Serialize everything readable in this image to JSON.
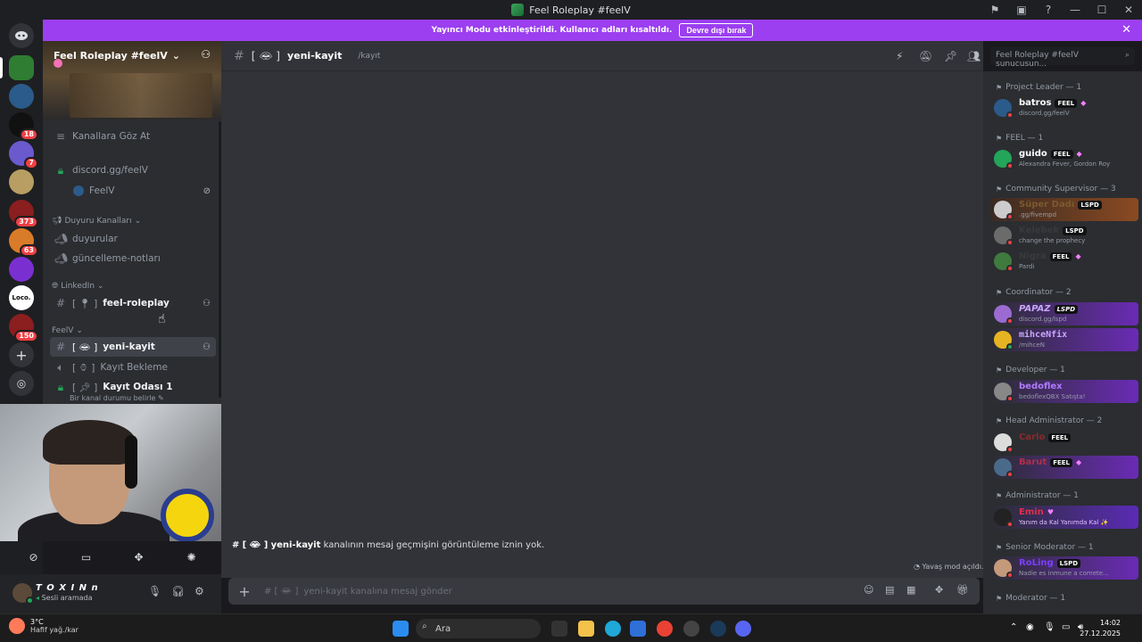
{
  "window": {
    "title": "Feel Roleplay #feelV"
  },
  "banner": {
    "text": "Yayıncı Modu etkinleştirildi. Kullanıcı adları kısaltıldı.",
    "button": "Devre dışı bırak"
  },
  "rail": {
    "badges": [
      "18",
      "7",
      "373",
      "63",
      "150"
    ],
    "loco_label": "Loco."
  },
  "server": {
    "name": "Feel Roleplay #feelV",
    "browse": "Kanallara Göz At",
    "link_channel": "discord.gg/feelV",
    "link_sub": "FeelV",
    "categories": {
      "announcements": "Duyuru Kanalları",
      "linkedin": "LinkedIn",
      "feelv": "FeelV"
    },
    "channels": {
      "duyurular": "duyurular",
      "guncelleme": "güncelleme-notları",
      "feel_roleplay": "feel-roleplay",
      "yeni_kayit": "yeni-kayit",
      "kayit_bekleme": "Kayıt Bekleme",
      "kayit_odasi": "Kayıt Odası 1"
    },
    "status_line": "Bir kanal durumu belirle"
  },
  "user": {
    "name": "T O X I N n",
    "status": "Sesli aramada"
  },
  "chat": {
    "channel": "yeni-kayit",
    "topic": "/kayıt",
    "no_permission_channel": "yeni-kayit",
    "no_permission_text": "kanalının mesaj geçmişini görüntüleme iznin yok.",
    "slow_mode": "Yavaş mod açıldı.",
    "composer_placeholder": "yeni-kayit kanalına mesaj gönder",
    "search_placeholder": "Feel Roleplay #feelV sunucusun..."
  },
  "members": {
    "roles": [
      {
        "name": "Project Leader — 1"
      },
      {
        "name": "FEEL — 1"
      },
      {
        "name": "Community Supervisor — 3"
      },
      {
        "name": "Coordinator — 2"
      },
      {
        "name": "Developer — 1"
      },
      {
        "name": "Head Administrator — 2"
      },
      {
        "name": "Administrator — 1"
      },
      {
        "name": "Senior Moderator — 1"
      },
      {
        "name": "Moderator — 1"
      }
    ],
    "list": [
      {
        "name": "batros",
        "tag": "FEEL",
        "sub": "discord.gg/feelV"
      },
      {
        "name": "guido",
        "tag": "FEEL",
        "sub": "Alexandra Fever, Gordon Roy"
      },
      {
        "name": "Süper Dadı",
        "tag": "LSPD",
        "sub": ".gg/fivempd"
      },
      {
        "name": "Kelebek",
        "tag": "LSPD",
        "sub": "change the prophecy"
      },
      {
        "name": "Nigra",
        "tag": "FEEL",
        "sub": "Pardi"
      },
      {
        "name": "PAPAZ",
        "tag": "LSPD",
        "sub": "discord.gg/lspd"
      },
      {
        "name": "mihceNfix",
        "tag": "",
        "sub": "/mihceN"
      },
      {
        "name": "bedoflex",
        "tag": "",
        "sub": "bedoflexQBX Satışta!"
      },
      {
        "name": "Carlo",
        "tag": "FEEL",
        "sub": ""
      },
      {
        "name": "Barut",
        "tag": "FEEL",
        "sub": ""
      },
      {
        "name": "Emin",
        "tag": "",
        "sub": "Yanım da Kal Yanımda Kal ✨"
      },
      {
        "name": "RoLing",
        "tag": "LSPD",
        "sub": "Nadie es inmune a comete..."
      }
    ]
  },
  "taskbar": {
    "weather_temp": "3°C",
    "weather_desc": "Hafif yağ./kar",
    "search": "Ara",
    "time": "14:02",
    "date": "27.12.2025"
  }
}
